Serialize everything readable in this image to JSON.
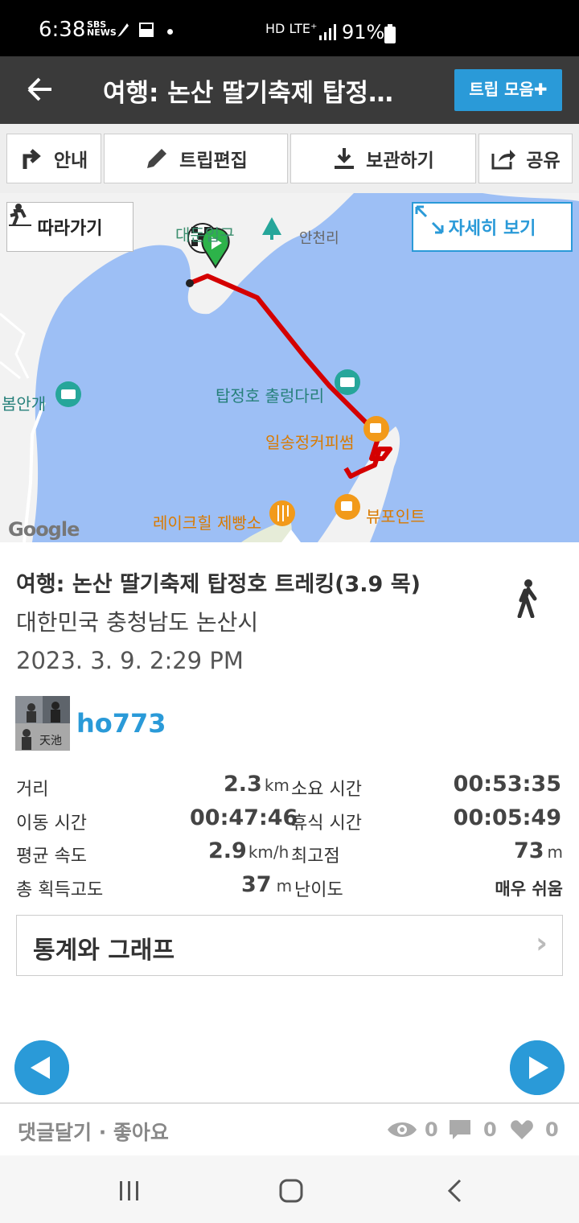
{
  "status_bar": {
    "time": "6:38",
    "sbs_top": "SBS",
    "sbs_bottom": "NEWS",
    "network": "HD LTE⁺",
    "battery": "91%"
  },
  "header": {
    "back_icon": "arrow-left-icon",
    "title": "여행: 논산 딸기축제 탑정…",
    "trips_button": "트립 모음✚"
  },
  "toolbar": {
    "guide": "안내",
    "edit": "트립편집",
    "save": "보관하기",
    "share": "공유"
  },
  "map": {
    "follow_button": "따라가기",
    "detail_button": "자세히 보기",
    "labels": {
      "entrance": "대둔입구",
      "ancheon": "안천리",
      "bridge": "탑정호 출렁다리",
      "cafe1": "일송정커피썸",
      "bakery": "레이크힐 제빵소",
      "viewpoint": "뷰포인트",
      "bomangae": "봄안개"
    },
    "google": "Google",
    "colors": {
      "water": "#9dbff5",
      "land": "#f2f2f2",
      "track": "#d40000",
      "poi_teal": "#26a69a",
      "poi_orange": "#f29a1a"
    }
  },
  "trip": {
    "title": "여행: 논산 딸기축제 탑정호 트레킹(3.9 목)",
    "location": "대한민국 충청남도 논산시",
    "datetime": "2023. 3. 9. 2:29 PM",
    "user": "ho773",
    "activity_icon": "walking-person-icon"
  },
  "stats": {
    "distance_label": "거리",
    "distance_value": "2.3",
    "distance_unit": "km",
    "total_time_label": "소요 시간",
    "total_time_value": "00:53:35",
    "moving_time_label": "이동 시간",
    "moving_time_value": "00:47:46",
    "rest_time_label": "휴식 시간",
    "rest_time_value": "00:05:49",
    "avg_speed_label": "평균 속도",
    "avg_speed_value": "2.9",
    "avg_speed_unit": "km/h",
    "max_alt_label": "최고점",
    "max_alt_value": "73",
    "max_alt_unit": "m",
    "gain_label": "총 획득고도",
    "gain_value": "37",
    "gain_unit": "m",
    "difficulty_label": "난이도",
    "difficulty_value": "매우 쉬움"
  },
  "graph_button": "통계와 그래프",
  "graph_chevron": "›",
  "footer": {
    "comment_like": "댓글달기 · 좋아요",
    "views": "0",
    "comments": "0",
    "likes": "0"
  }
}
